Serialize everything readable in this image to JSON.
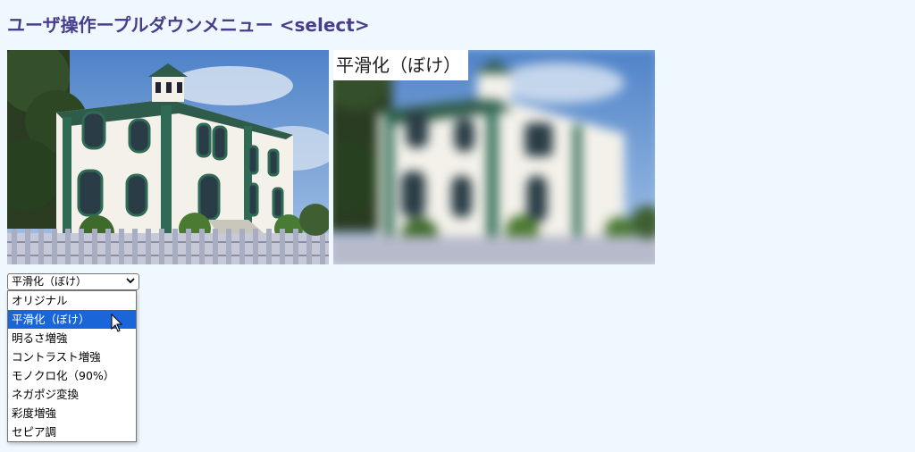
{
  "page": {
    "title": "ユーザ操作ープルダウンメニュー <select>"
  },
  "images": {
    "original_alt": "house photo",
    "effect_label": "平滑化（ぼけ）"
  },
  "select": {
    "current_value": "平滑化（ぼけ）",
    "options": [
      {
        "label": "オリジナル"
      },
      {
        "label": "平滑化（ぼけ）"
      },
      {
        "label": "明るさ増強"
      },
      {
        "label": "コントラスト増強"
      },
      {
        "label": "モノクロ化（90%）"
      },
      {
        "label": "ネガポジ変換"
      },
      {
        "label": "彩度増強"
      },
      {
        "label": "セピア調"
      }
    ],
    "highlighted_index": 1
  },
  "colors": {
    "background": "#f0f8ff",
    "title": "#483d8b",
    "highlight": "#1a66d8"
  }
}
